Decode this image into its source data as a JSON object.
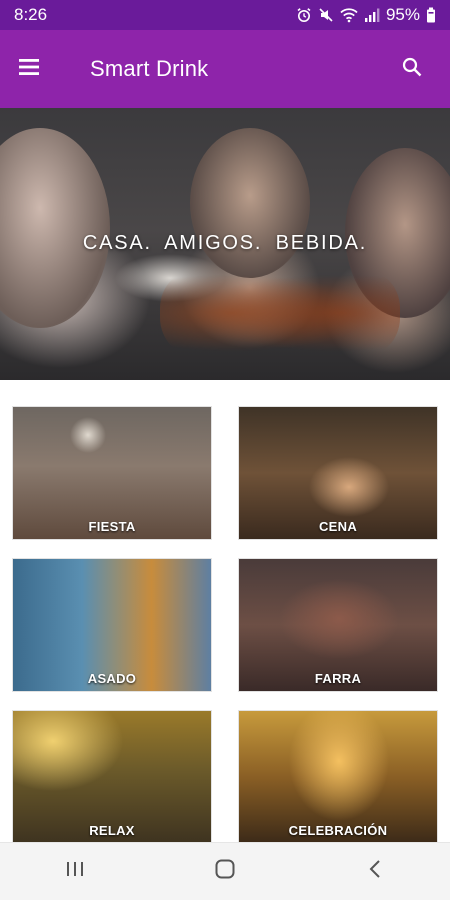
{
  "status_bar": {
    "time": "8:26",
    "battery": "95%",
    "icons": [
      "alarm-icon",
      "mute-icon",
      "wifi-icon",
      "signal-icon",
      "battery-icon"
    ]
  },
  "app_bar": {
    "title": "Smart Drink",
    "menu_icon": "hamburger-icon",
    "search_icon": "search-icon",
    "color": "#8e24aa"
  },
  "hero": {
    "tagline": "CASA. AMIGOS. BEBIDA."
  },
  "categories": [
    {
      "label": "FIESTA"
    },
    {
      "label": "CENA"
    },
    {
      "label": "ASADO"
    },
    {
      "label": "FARRA"
    },
    {
      "label": "RELAX"
    },
    {
      "label": "CELEBRACIÓN"
    }
  ],
  "nav_bar": {
    "icons": [
      "recents-icon",
      "home-icon",
      "back-icon"
    ]
  },
  "colors": {
    "status_bar": "#6a1b9a",
    "app_bar": "#8e24aa"
  }
}
